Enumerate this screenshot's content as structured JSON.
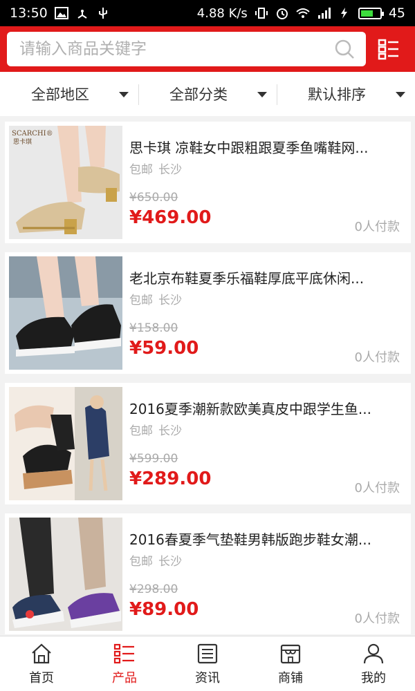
{
  "status_bar": {
    "time": "13:50",
    "network_speed": "4.88 K/s",
    "battery": "45"
  },
  "search": {
    "placeholder": "请输入商品关键字"
  },
  "filters": [
    {
      "label": "全部地区"
    },
    {
      "label": "全部分类"
    },
    {
      "label": "默认排序"
    }
  ],
  "products": [
    {
      "title": "思卡琪 凉鞋女中跟粗跟夏季鱼嘴鞋网...",
      "shipping": "包邮",
      "location": "长沙",
      "original_price": "¥650.00",
      "price": "¥469.00",
      "sales": "0人付款",
      "image_brand": "SCARCHI®",
      "image_brand_cn": "思卡琪"
    },
    {
      "title": "老北京布鞋夏季乐福鞋厚底平底休闲...",
      "shipping": "包邮",
      "location": "长沙",
      "original_price": "¥158.00",
      "price": "¥59.00",
      "sales": "0人付款"
    },
    {
      "title": "2016夏季潮新款欧美真皮中跟学生鱼...",
      "shipping": "包邮",
      "location": "长沙",
      "original_price": "¥599.00",
      "price": "¥289.00",
      "sales": "0人付款"
    },
    {
      "title": "2016春夏季气垫鞋男韩版跑步鞋女潮...",
      "shipping": "包邮",
      "location": "长沙",
      "original_price": "¥298.00",
      "price": "¥89.00",
      "sales": "0人付款"
    }
  ],
  "bottom_nav": [
    {
      "label": "首页",
      "icon": "home-icon"
    },
    {
      "label": "产品",
      "icon": "list-icon",
      "active": true
    },
    {
      "label": "资讯",
      "icon": "news-icon"
    },
    {
      "label": "商铺",
      "icon": "shop-icon"
    },
    {
      "label": "我的",
      "icon": "user-icon"
    }
  ],
  "colors": {
    "accent": "#e11a1a",
    "muted_text": "#aaaaaa",
    "battery": "#3ddc3d"
  }
}
